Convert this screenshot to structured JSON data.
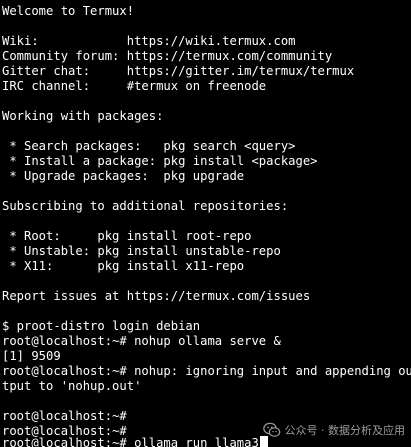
{
  "terminal": {
    "lines": [
      "Welcome to Termux!",
      "",
      "Wiki:            https://wiki.termux.com",
      "Community forum: https://termux.com/community",
      "Gitter chat:     https://gitter.im/termux/termux",
      "IRC channel:     #termux on freenode",
      "",
      "Working with packages:",
      "",
      " * Search packages:   pkg search <query>",
      " * Install a package: pkg install <package>",
      " * Upgrade packages:  pkg upgrade",
      "",
      "Subscribing to additional repositories:",
      "",
      " * Root:     pkg install root-repo",
      " * Unstable: pkg install unstable-repo",
      " * X11:      pkg install x11-repo",
      "",
      "Report issues at https://termux.com/issues",
      "",
      "$ proot-distro login debian",
      "root@localhost:~# nohup ollama serve &",
      "[1] 9509",
      "root@localhost:~# nohup: ignoring input and appending ou",
      "tput to 'nohup.out'",
      "",
      "root@localhost:~#",
      "root@localhost:~#",
      "root@localhost:~# ollama run llama3"
    ]
  },
  "watermark": {
    "text": "公众号 · 数据分析及应用",
    "icon": "wechat-icon"
  },
  "colors": {
    "background": "#000000",
    "foreground": "#ffffff"
  }
}
